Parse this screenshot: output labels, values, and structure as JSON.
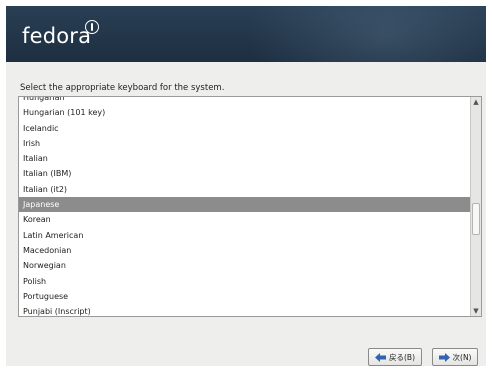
{
  "header": {
    "logo_text": "fedora"
  },
  "keyboard": {
    "prompt": "Select the appropriate keyboard for the system.",
    "items": [
      "Hungarian",
      "Hungarian (101 key)",
      "Icelandic",
      "Irish",
      "Italian",
      "Italian (IBM)",
      "Italian (it2)",
      "Japanese",
      "Korean",
      "Latin American",
      "Macedonian",
      "Norwegian",
      "Polish",
      "Portuguese",
      "Punjabi (Inscript)"
    ],
    "selected": "Japanese"
  },
  "buttons": {
    "back_label": "戻る(B)",
    "next_label": "次(N)"
  },
  "icons": {
    "back": "arrow-left-icon",
    "next": "arrow-right-icon",
    "scroll_up": "scroll-up-arrow-icon",
    "scroll_down": "scroll-down-arrow-icon"
  },
  "colors": {
    "banner": "#233649",
    "selection": "#8c8c8c",
    "arrow_icon": "#2f63b4"
  }
}
